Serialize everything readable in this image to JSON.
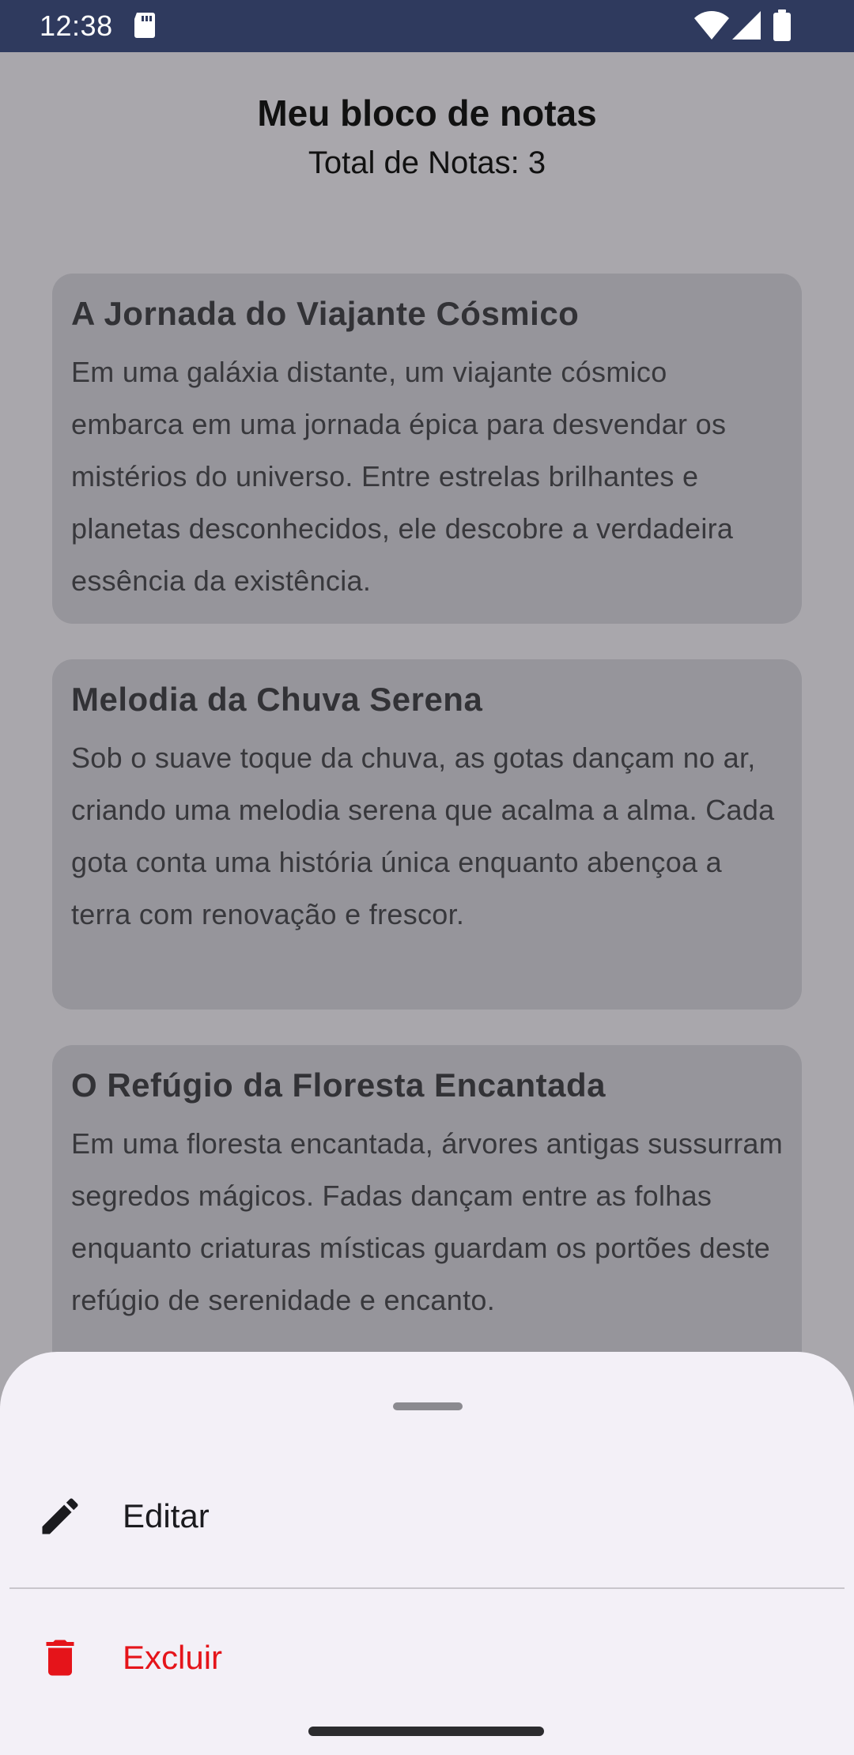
{
  "status_bar": {
    "time": "12:38",
    "icons": [
      "sd-card-icon",
      "wifi-icon",
      "signal-icon",
      "battery-icon"
    ],
    "background": "#2f3a5e"
  },
  "header": {
    "title": "Meu bloco de notas",
    "subtitle": "Total de Notas: 3"
  },
  "notes": [
    {
      "title": "A Jornada do Viajante Cósmico",
      "body": "Em uma galáxia distante, um viajante cósmico embarca em uma jornada épica para desvendar os mistérios do universo. Entre estrelas brilhantes e planetas desconhecidos, ele descobre a verdadeira essência da existência."
    },
    {
      "title": "Melodia da Chuva Serena",
      "body": "Sob o suave toque da chuva, as gotas dançam no ar, criando uma melodia serena que acalma a alma. Cada gota conta uma história única enquanto abençoa a terra com renovação e frescor."
    },
    {
      "title": "O Refúgio da Floresta Encantada",
      "body": "Em uma floresta encantada, árvores antigas sussurram segredos mágicos. Fadas dançam entre as folhas enquanto criaturas místicas guardam os portões deste refúgio de serenidade e encanto."
    }
  ],
  "bottom_sheet": {
    "actions": [
      {
        "label": "Editar",
        "icon": "pencil-icon",
        "color": "#1b1b1f"
      },
      {
        "label": "Excluir",
        "icon": "trash-icon",
        "color": "#e5141a"
      }
    ]
  },
  "colors": {
    "scrim_background": "#a9a7ac",
    "card_background": "#96959b",
    "sheet_background": "#f3f0f7",
    "danger": "#e5141a"
  }
}
